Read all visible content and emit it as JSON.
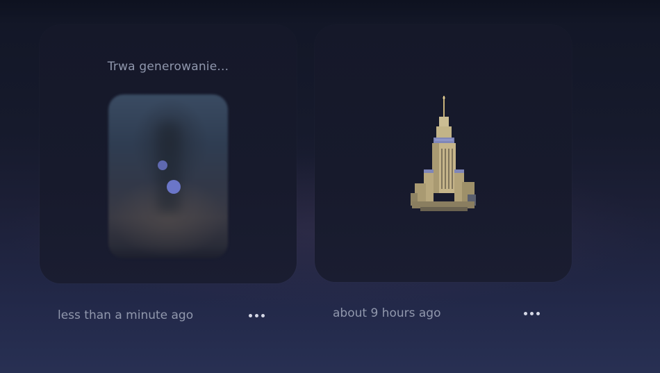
{
  "cards": [
    {
      "status": "Trwa generowanie...",
      "timestamp": "less than a minute ago"
    },
    {
      "timestamp": "about 9 hours ago",
      "image_subject": "palace-of-culture-tower"
    }
  ],
  "colors": {
    "background_top": "#121626",
    "background_bottom": "#283053",
    "card": "#161a2b",
    "dot_accent": "#6b76c8",
    "text_muted": "#9198ad"
  },
  "icons": {
    "more": "more-horizontal-icon"
  }
}
